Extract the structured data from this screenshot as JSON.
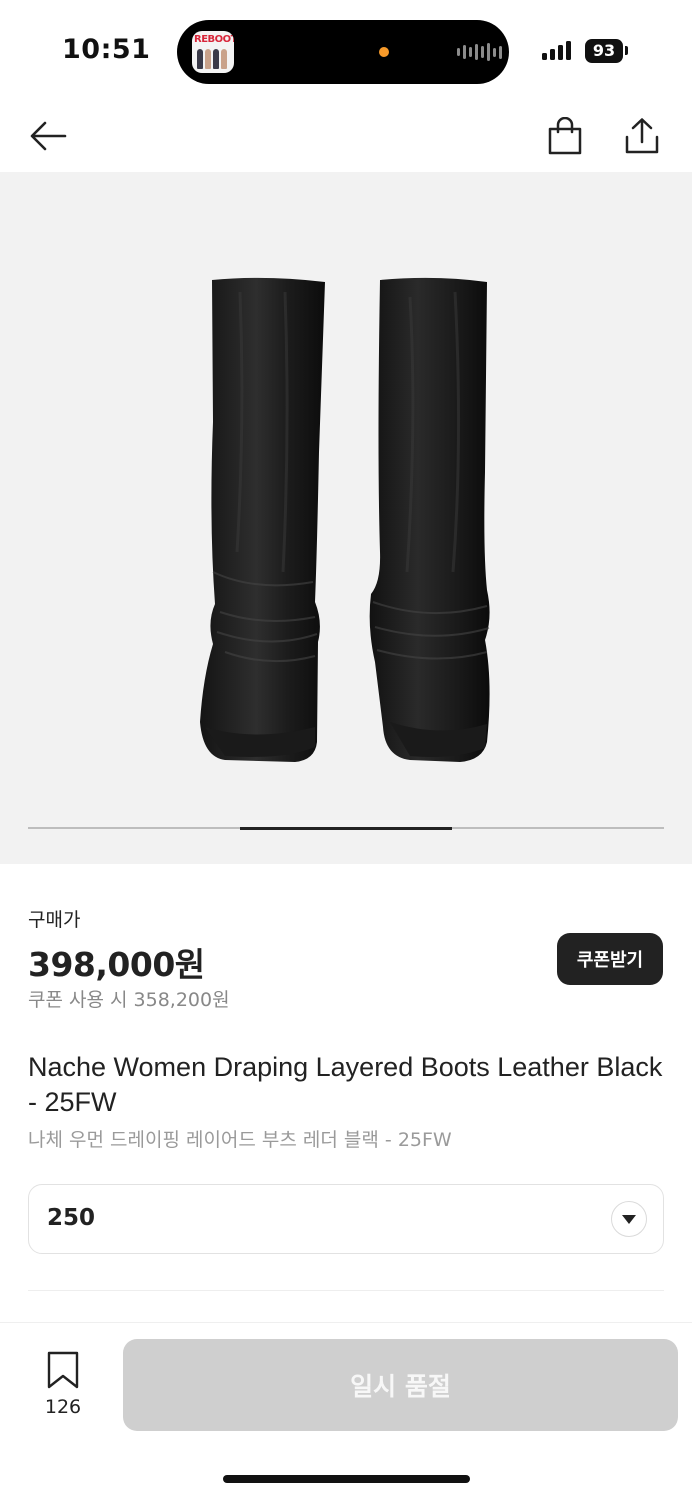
{
  "status_bar": {
    "time": "10:51",
    "live_activity_app": "REBOOT",
    "battery": "93",
    "live_dot_color": "#f79a2a"
  },
  "nav": {
    "back_icon": "arrow-left-icon",
    "bag_icon": "shopping-bag-icon",
    "share_icon": "share-icon"
  },
  "product_image": {
    "subject": "boots-icon",
    "carousel_position": "2 of 3"
  },
  "price": {
    "label": "구매가",
    "amount": "398,000원",
    "coupon_price": "쿠폰 사용 시 358,200원",
    "coupon_button": "쿠폰받기"
  },
  "product": {
    "title_en": "Nache Women Draping Layered Boots Leather Black - 25FW",
    "title_ko": "나체 우먼 드레이핑 레이어드 부츠 레더 블랙 - 25FW"
  },
  "size_select": {
    "selected": "250",
    "icon": "chevron-down-icon"
  },
  "bottom_bar": {
    "save_icon": "bookmark-icon",
    "save_count": "126",
    "buy_button": "일시 품절",
    "buy_button_color": "#cfcfcf"
  }
}
